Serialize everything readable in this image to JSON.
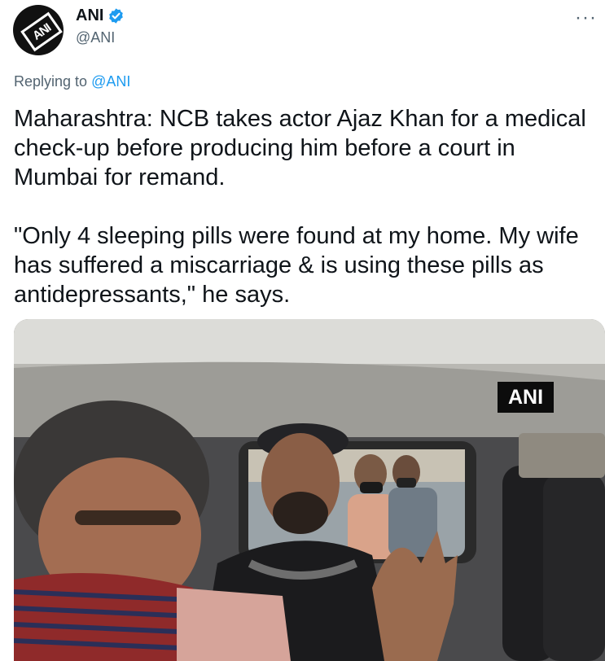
{
  "tweet": {
    "author": {
      "display_name": "ANI",
      "handle": "@ANI",
      "verified": true,
      "avatar_text": "ANI"
    },
    "more_icon": "more-horizontal-icon",
    "reply_prefix": "Replying to",
    "reply_to": "@ANI",
    "text": "Maharashtra: NCB takes actor Ajaz Khan for a medical check-up before producing him before a court in Mumbai for remand.\n\n\"Only 4 sleeping pills were found at my home. My wife has suffered a miscarriage & is using these pills as antidepressants,\" he says.",
    "media": {
      "watermark": "ANI"
    }
  },
  "colors": {
    "verified_badge": "#1d9bf0",
    "mention": "#1d9bf0",
    "secondary_text": "#536471"
  }
}
